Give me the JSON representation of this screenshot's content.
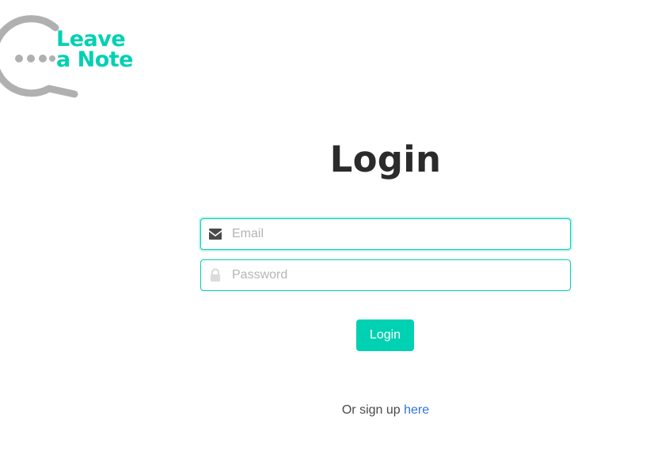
{
  "logo": {
    "line1": "Leave",
    "line2": "a Note",
    "accent_color": "#00d1b2",
    "bubble_color": "#b0b0b0"
  },
  "title": "Login",
  "form": {
    "email": {
      "placeholder": "Email",
      "value": "",
      "icon": "envelope-icon"
    },
    "password": {
      "placeholder": "Password",
      "value": "",
      "icon": "lock-icon"
    },
    "submit_label": "Login"
  },
  "signup": {
    "prefix": "Or sign up",
    "link_label": "here"
  },
  "colors": {
    "primary": "#00d1b2",
    "link": "#3273dc",
    "text": "#363636"
  }
}
